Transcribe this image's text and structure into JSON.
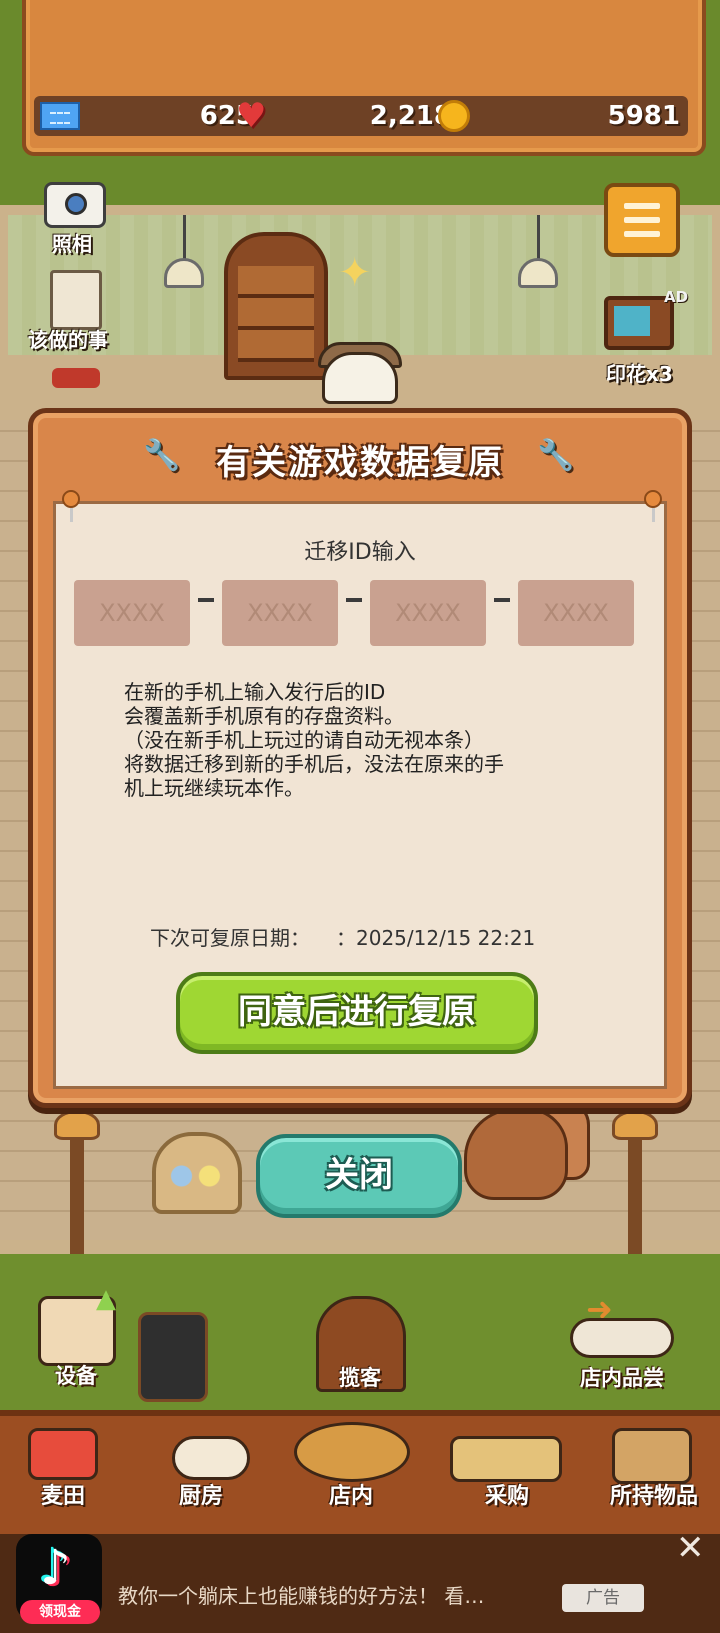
{
  "hud": {
    "tickets": "625",
    "hearts": "2,218",
    "coins": "5981"
  },
  "scene": {
    "camera_label": "照相",
    "todo_label": "该做的事",
    "stamp_label": "印花x3",
    "ad_tag": "AD"
  },
  "dialog": {
    "title": "有关游戏数据复原",
    "migrate_label": "迁移ID输入",
    "id_placeholder": "XXXX",
    "info_lines": [
      "在新的手机上输入发行后的ID",
      "会覆盖新手机原有的存盘资料。",
      "（没在新手机上玩过的请自动无视本条）",
      "将数据迁移到新的手机后，没法在原来的手",
      "机上玩继续玩本作。"
    ],
    "date_label": "下次可复原日期：",
    "date_value": "：2025/12/15 22:21",
    "agree_button": "同意后进行复原"
  },
  "close_button": "关闭",
  "actions": {
    "equipment": "设备",
    "attract": "揽客",
    "tasting": "店内品尝"
  },
  "nav": {
    "wheat": "麦田",
    "kitchen": "厨房",
    "store": "店内",
    "purchase": "采购",
    "items": "所持物品"
  },
  "ad": {
    "badge_reward": "领现金",
    "text": "教你一个躺床上也能赚钱的好方法！ 看…",
    "label": "广告"
  },
  "colors": {
    "wood": "#d9864a",
    "paper": "#f1e4d4",
    "agree_green": "#9fd733",
    "close_teal": "#5cc9b6"
  }
}
